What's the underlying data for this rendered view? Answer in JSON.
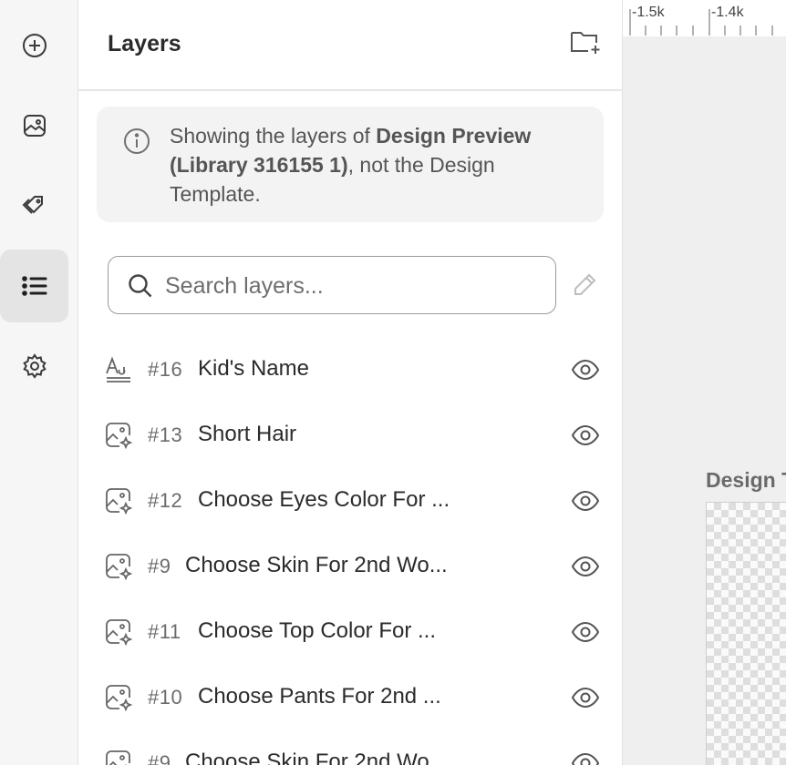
{
  "panel": {
    "title": "Layers"
  },
  "notice": {
    "text_pre": "Showing the layers of ",
    "text_bold": "Design Preview (Library 316155 1)",
    "text_post": ", not the Design Template."
  },
  "search": {
    "placeholder": "Search layers..."
  },
  "layers": [
    {
      "type": "text-icon",
      "number": "#16",
      "name": "Kid's Name"
    },
    {
      "type": "image-sparkle-icon",
      "number": "#13",
      "name": "Short Hair"
    },
    {
      "type": "image-sparkle-icon",
      "number": "#12",
      "name": "Choose Eyes Color For ..."
    },
    {
      "type": "image-sparkle-icon",
      "number": "#9",
      "name": "Choose Skin For 2nd Wo..."
    },
    {
      "type": "image-sparkle-icon",
      "number": "#11",
      "name": "Choose Top Color For ..."
    },
    {
      "type": "image-sparkle-icon",
      "number": "#10",
      "name": "Choose Pants For 2nd ..."
    },
    {
      "type": "image-sparkle-icon",
      "number": "#9",
      "name": "Choose Skin For 2nd Wo..."
    }
  ],
  "canvas": {
    "ruler_labels": [
      "-1.5k",
      "-1.4k"
    ],
    "design_label": "Design T"
  },
  "rail": {
    "items": [
      "add-icon",
      "image-icon",
      "tags-icon",
      "layers-list-icon",
      "settings-icon"
    ],
    "active": "layers-list-icon"
  }
}
